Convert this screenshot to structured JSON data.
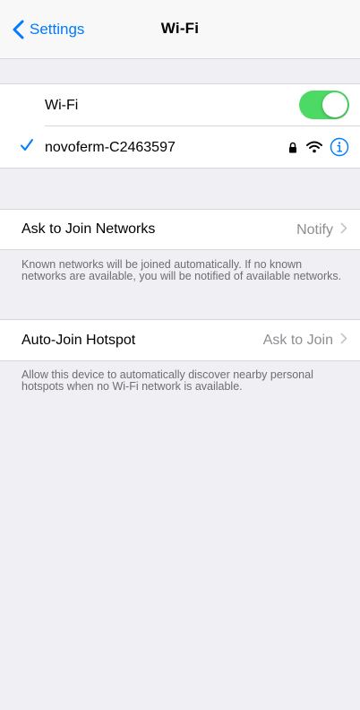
{
  "navbar": {
    "back_label": "Settings",
    "title": "Wi-Fi"
  },
  "wifi_group": {
    "wifi_label": "Wi-Fi",
    "wifi_enabled": true,
    "connected_network": "novoferm-C2463597",
    "toggle_color": "#4cd964",
    "accent_color": "#007aff",
    "network_icons": [
      "lock-icon",
      "wifi-signal-icon",
      "info-icon"
    ]
  },
  "ask_to_join": {
    "label": "Ask to Join Networks",
    "value": "Notify",
    "footnote": "Known networks will be joined automatically. If no known networks are available, you will be notified of available networks."
  },
  "auto_join_hotspot": {
    "label": "Auto-Join Hotspot",
    "value": "Ask to Join",
    "footnote": "Allow this device to automatically discover nearby personal hotspots when no Wi-Fi network is available."
  }
}
